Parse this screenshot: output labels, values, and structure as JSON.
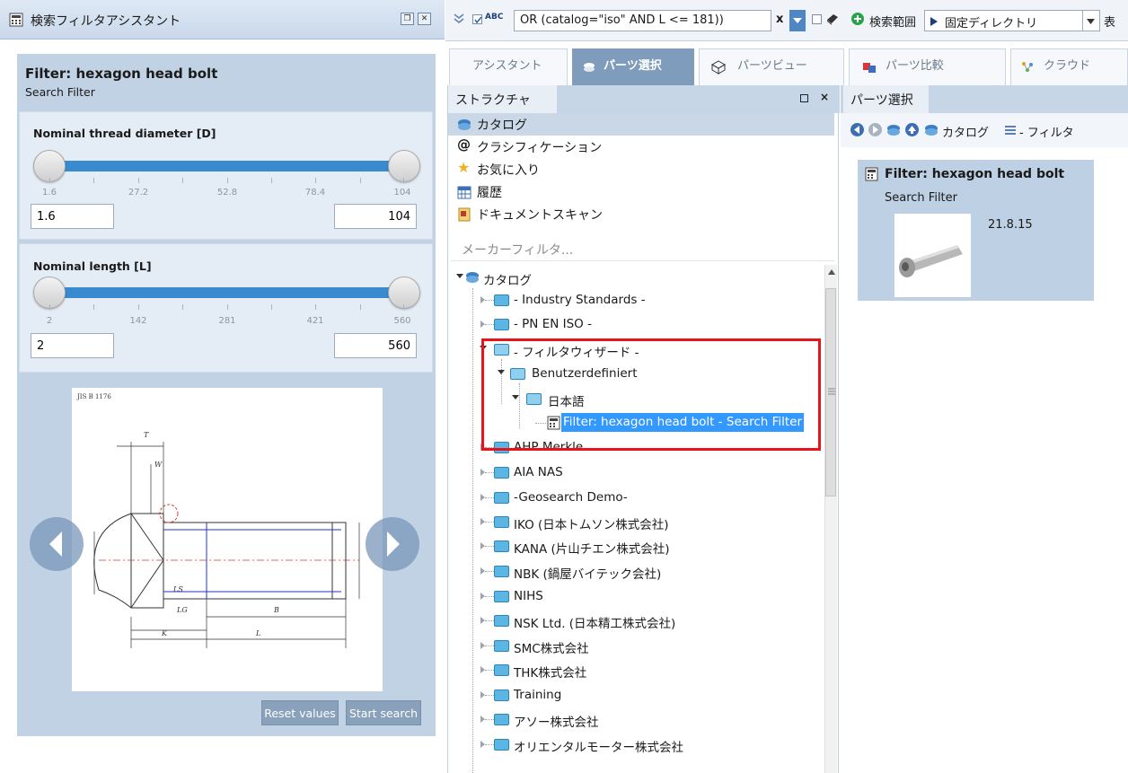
{
  "left_panel": {
    "title": "検索フィルタアシスタント",
    "filter_title": "Filter: hexagon head bolt",
    "filter_subtitle": "Search Filter",
    "params": [
      {
        "label": "Nominal thread diameter [D]",
        "ticks": [
          "1.6",
          "27.2",
          "52.8",
          "78.4",
          "104"
        ],
        "min_value": "1.6",
        "max_value": "104"
      },
      {
        "label": "Nominal length [L]",
        "ticks": [
          "2",
          "142",
          "281",
          "421",
          "560"
        ],
        "min_value": "2",
        "max_value": "560"
      }
    ],
    "drawing_caption": "JIS B 1176",
    "buttons": {
      "reset": "Reset values",
      "start": "Start search"
    }
  },
  "toolbar": {
    "abc_label": "ABC",
    "query": "OR (catalog=\"iso\" AND L <= 181))",
    "query_clear": "x",
    "search_range_label": "検索範囲",
    "fixed_dir_label": "固定ディレクトリ",
    "trailing_label": "表"
  },
  "tabs": [
    {
      "label": "アシスタント",
      "active": false
    },
    {
      "label": "パーツ選択",
      "active": true
    },
    {
      "label": "パーツビュー",
      "active": false
    },
    {
      "label": "パーツ比較",
      "active": false
    },
    {
      "label": "クラウド",
      "active": false
    }
  ],
  "structure": {
    "title": "ストラクチャ",
    "nav_items": [
      {
        "label": "カタログ",
        "icon": "catalog-icon",
        "selected": true
      },
      {
        "label": "クラシフィケーション",
        "icon": "at-icon",
        "selected": false
      },
      {
        "label": "お気に入り",
        "icon": "star-icon",
        "selected": false
      },
      {
        "label": "履歴",
        "icon": "calendar-icon",
        "selected": false
      },
      {
        "label": "ドキュメントスキャン",
        "icon": "scan-icon",
        "selected": false
      }
    ],
    "maker_filter_placeholder": "メーカーフィルタ...",
    "tree": {
      "root": "カタログ",
      "items": [
        "- Industry Standards -",
        "- PN EN ISO -",
        "- フィルタウィザード -",
        "Benutzerdefiniert",
        "日本語",
        "Filter: hexagon head bolt - Search Filter",
        "AHP Merkle",
        "AIA NAS",
        "-Geosearch Demo-",
        "IKO (日本トムソン株式会社)",
        "KANA (片山チエン株式会社)",
        "NBK (鍋屋バイテック会社)",
        "NIHS",
        "NSK Ltd. (日本精工株式会社)",
        "SMC株式会社",
        "THK株式会社",
        "Training",
        "アソー株式会社",
        "オリエンタルモーター株式会社"
      ]
    }
  },
  "parts": {
    "title": "パーツ選択",
    "breadcrumb_catalog": "カタログ",
    "breadcrumb_filter": "- フィルタ",
    "card": {
      "title": "Filter: hexagon head bolt",
      "subtitle": "Search Filter",
      "date": "21.8.15"
    }
  },
  "colors": {
    "accent_blue": "#3a8ad0",
    "panel_blue": "#c1d2e4",
    "highlight_red": "#e8141c",
    "selection_blue": "#3399ff"
  }
}
